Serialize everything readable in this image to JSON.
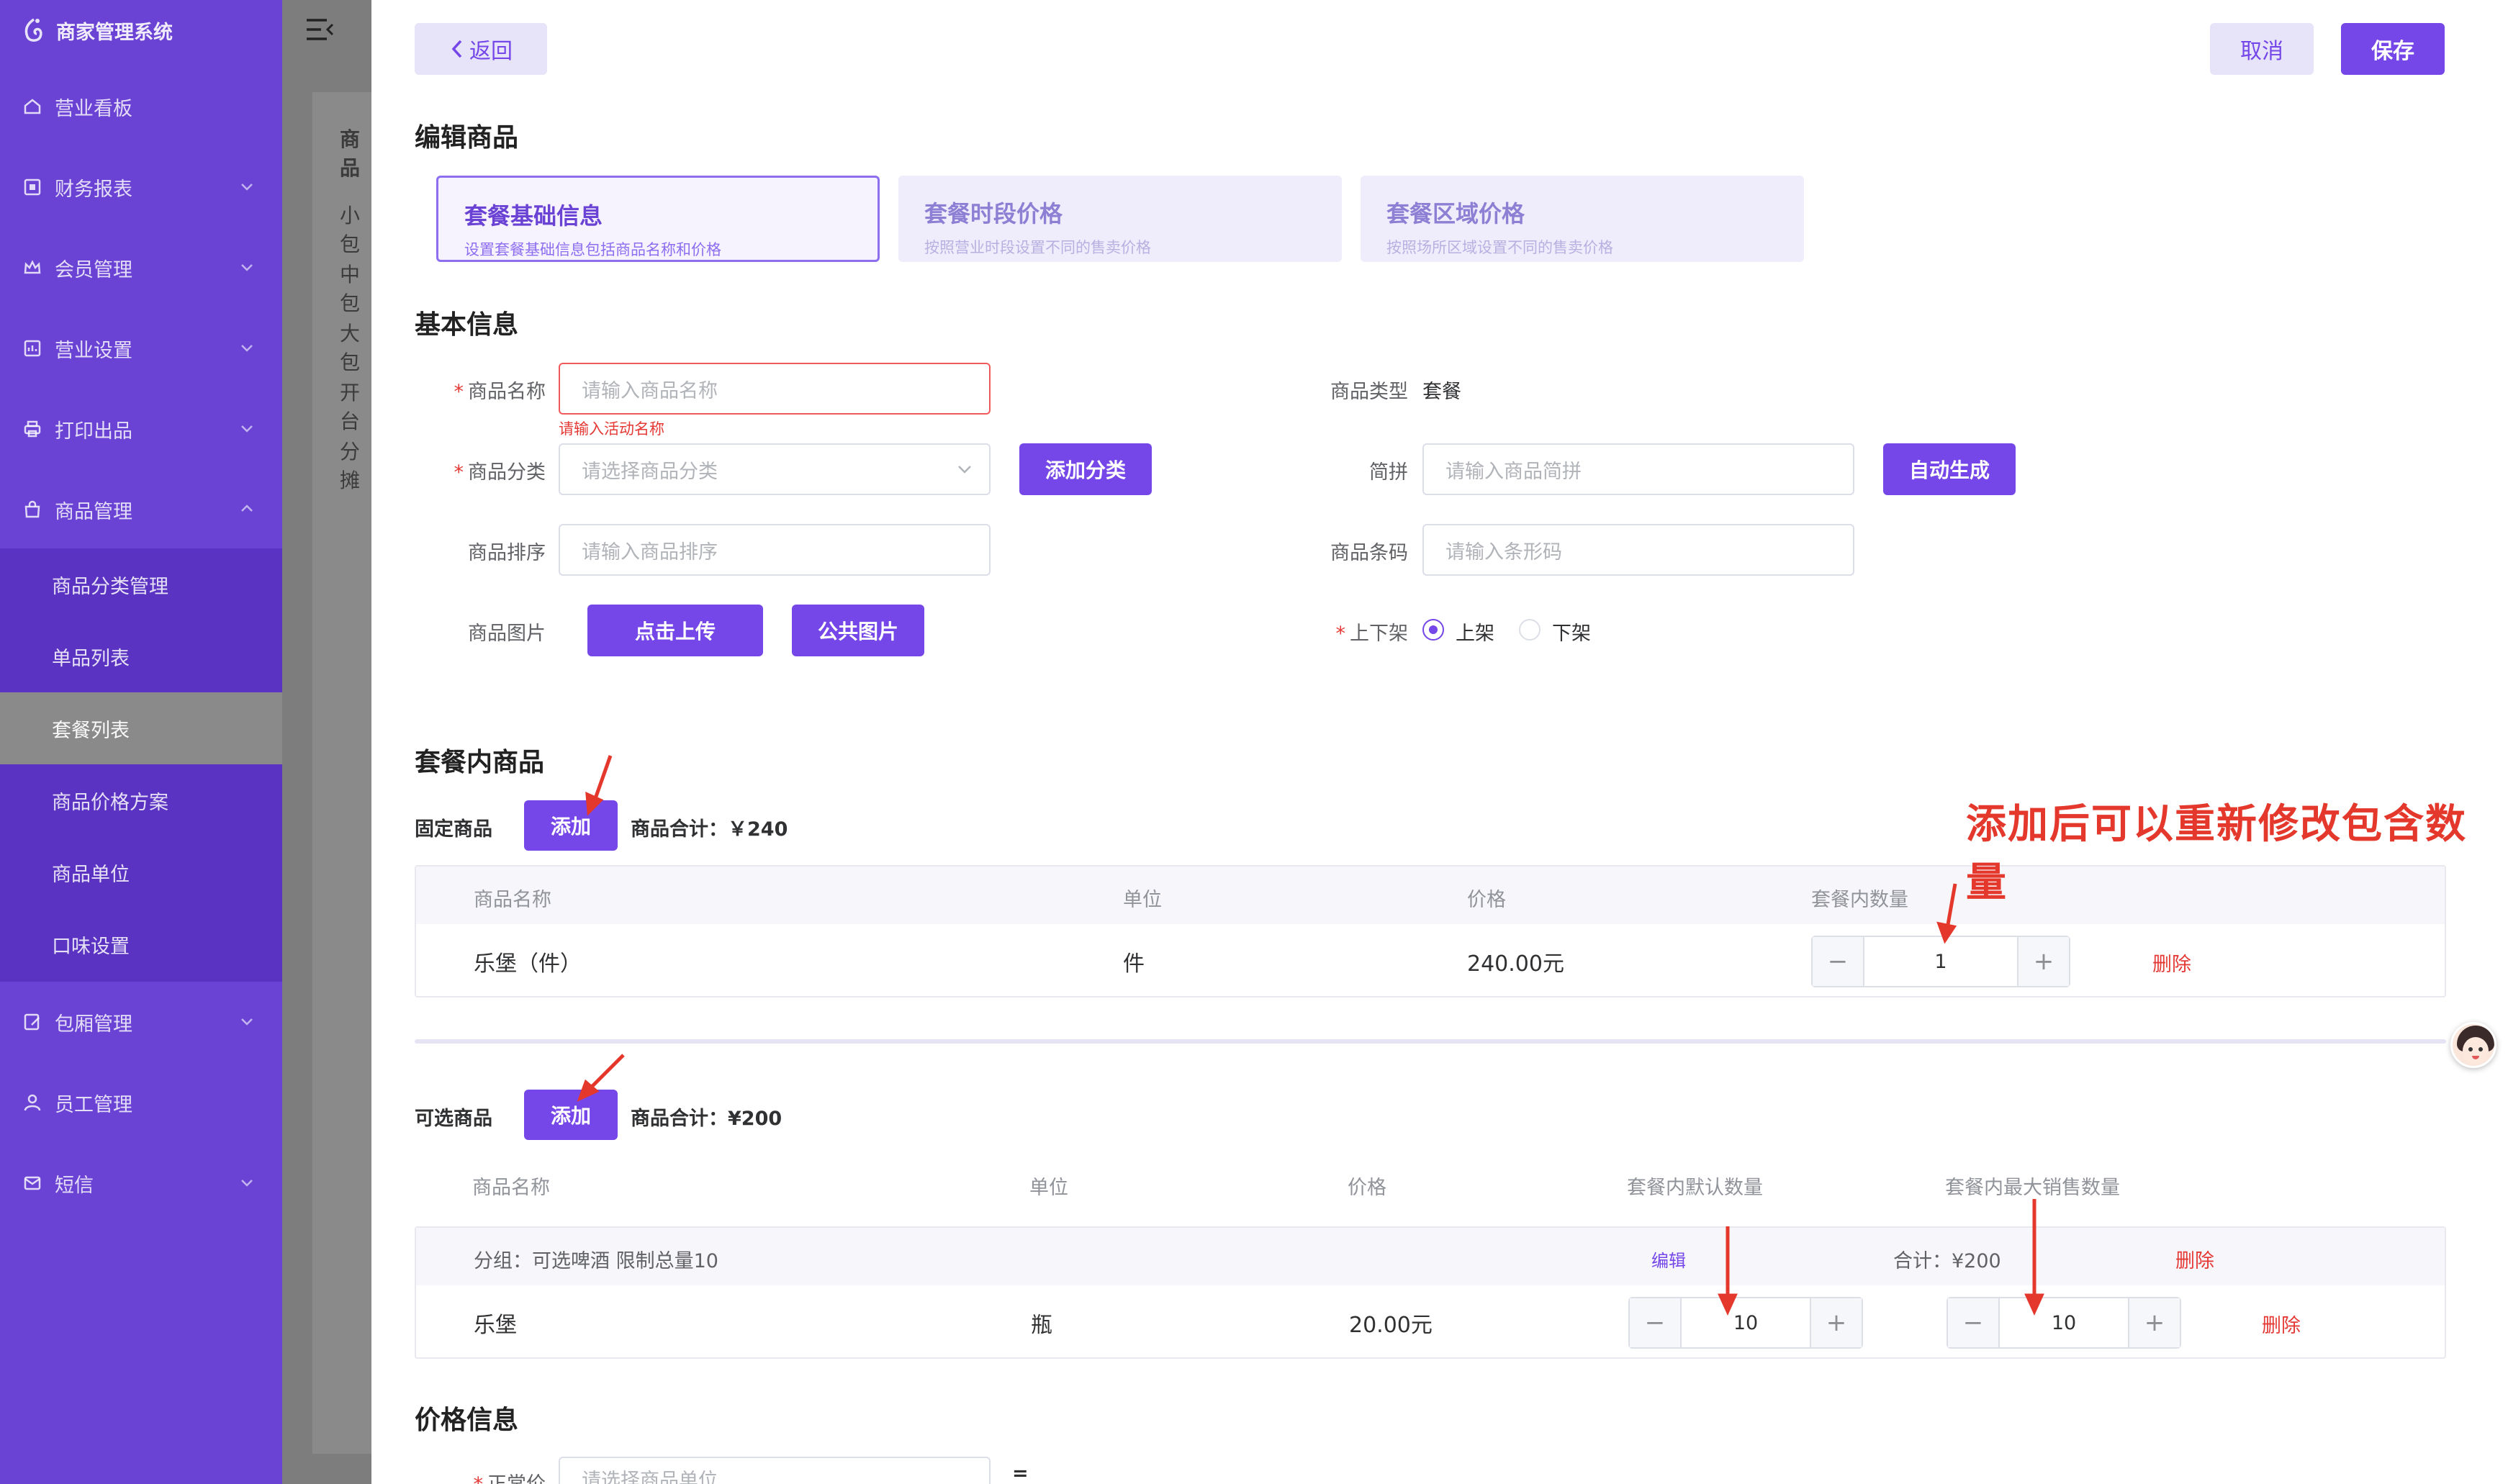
{
  "sidebar": {
    "app_title": "商家管理系统",
    "items": [
      {
        "label": "营业看板"
      },
      {
        "label": "财务报表"
      },
      {
        "label": "会员管理"
      },
      {
        "label": "营业设置"
      },
      {
        "label": "打印出品"
      },
      {
        "label": "商品管理"
      },
      {
        "label": "包厢管理"
      },
      {
        "label": "员工管理"
      },
      {
        "label": "短信"
      }
    ],
    "submenu": [
      {
        "label": "商品分类管理"
      },
      {
        "label": "单品列表"
      },
      {
        "label": "套餐列表"
      },
      {
        "label": "商品价格方案"
      },
      {
        "label": "商品单位"
      },
      {
        "label": "口味设置"
      }
    ]
  },
  "background_page": {
    "card_title": "商品",
    "rows": [
      "小包",
      "中包",
      "大包",
      "开台",
      "分摊"
    ]
  },
  "drawer": {
    "back_label": "返回",
    "cancel_label": "取消",
    "save_label": "保存",
    "title": "编辑商品",
    "steps": [
      {
        "title": "套餐基础信息",
        "desc": "设置套餐基础信息包括商品名称和价格"
      },
      {
        "title": "套餐时段价格",
        "desc": "按照营业时段设置不同的售卖价格"
      },
      {
        "title": "套餐区域价格",
        "desc": "按照场所区域设置不同的售卖价格"
      }
    ],
    "basic": {
      "title": "基本信息",
      "name_label": "商品名称",
      "name_placeholder": "请输入商品名称",
      "name_error": "请输入活动名称",
      "category_label": "商品分类",
      "category_placeholder": "请选择商品分类",
      "add_category_label": "添加分类",
      "sort_label": "商品排序",
      "sort_placeholder": "请输入商品排序",
      "image_label": "商品图片",
      "upload_label": "点击上传",
      "public_image_label": "公共图片",
      "type_label": "商品类型",
      "type_value": "套餐",
      "pinyin_label": "简拼",
      "pinyin_placeholder": "请输入商品简拼",
      "auto_generate_label": "自动生成",
      "barcode_label": "商品条码",
      "barcode_placeholder": "请输入条形码",
      "shelf_label": "上下架",
      "on_shelf": "上架",
      "off_shelf": "下架"
    },
    "package": {
      "title": "套餐内商品",
      "fixed": {
        "label": "固定商品",
        "add_label": "添加",
        "total": "商品合计：￥240",
        "headers": [
          "商品名称",
          "单位",
          "价格",
          "套餐内数量"
        ],
        "rows": [
          {
            "name": "乐堡（件）",
            "unit": "件",
            "price": "240.00元",
            "qty": "1",
            "delete": "删除"
          }
        ]
      },
      "optional": {
        "label": "可选商品",
        "add_label": "添加",
        "total": "商品合计：¥200",
        "headers": [
          "商品名称",
          "单位",
          "价格",
          "套餐内默认数量",
          "套餐内最大销售数量"
        ],
        "group": {
          "text": "分组：可选啤酒 限制总量10",
          "edit": "编辑",
          "sum": "合计：¥200",
          "delete": "删除"
        },
        "rows": [
          {
            "name": "乐堡",
            "unit": "瓶",
            "price": "20.00元",
            "default_qty": "10",
            "max_qty": "10",
            "delete": "删除"
          }
        ]
      }
    },
    "price": {
      "title": "价格信息",
      "field_label": "正常价",
      "field_placeholder": "请选择商品单位"
    },
    "annotation": "添加后可以重新修改包含数量"
  },
  "colors": {
    "sidebar": "#6a42d4",
    "submenu": "#5a33c2",
    "accent": "#7546e8",
    "danger": "#e53935",
    "annotation": "#e5382c"
  }
}
